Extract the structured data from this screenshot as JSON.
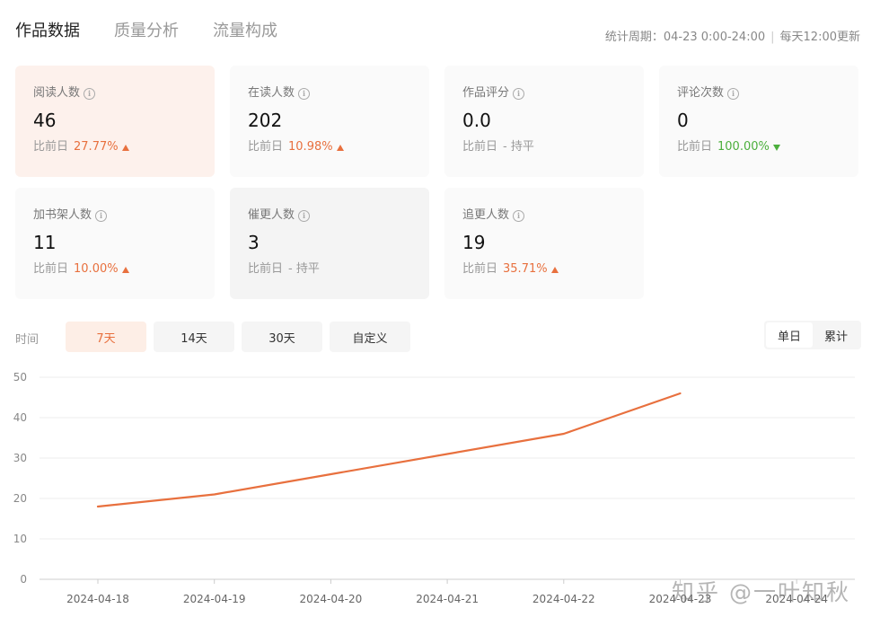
{
  "tabs": [
    {
      "label": "作品数据",
      "active": true
    },
    {
      "label": "质量分析",
      "active": false
    },
    {
      "label": "流量构成",
      "active": false
    }
  ],
  "period": {
    "label": "统计周期：04-23 0:00-24:00",
    "refresh": "每天12:00更新"
  },
  "cards": [
    {
      "label": "阅读人数",
      "value": "46",
      "compare_label": "比前日",
      "change": "27.77%",
      "trend": "up"
    },
    {
      "label": "在读人数",
      "value": "202",
      "compare_label": "比前日",
      "change": "10.98%",
      "trend": "up"
    },
    {
      "label": "作品评分",
      "value": "0.0",
      "compare_label": "比前日",
      "change": "- 持平",
      "trend": "flat"
    },
    {
      "label": "评论次数",
      "value": "0",
      "compare_label": "比前日",
      "change": "100.00%",
      "trend": "down"
    },
    {
      "label": "加书架人数",
      "value": "11",
      "compare_label": "比前日",
      "change": "10.00%",
      "trend": "up"
    },
    {
      "label": "催更人数",
      "value": "3",
      "compare_label": "比前日",
      "change": "- 持平",
      "trend": "flat"
    },
    {
      "label": "追更人数",
      "value": "19",
      "compare_label": "比前日",
      "change": "35.71%",
      "trend": "up"
    }
  ],
  "time_filter": {
    "label": "时间",
    "options": [
      "7天",
      "14天",
      "30天",
      "自定义"
    ],
    "selected": "7天"
  },
  "view_toggle": {
    "options": [
      "单日",
      "累计"
    ],
    "selected": "单日"
  },
  "chart_data": {
    "type": "line",
    "x": [
      "2024-04-18",
      "2024-04-19",
      "2024-04-20",
      "2024-04-21",
      "2024-04-22",
      "2024-04-23",
      "2024-04-24"
    ],
    "series": [
      {
        "values": [
          18,
          21,
          26,
          31,
          36,
          46,
          null
        ]
      }
    ],
    "ylim": [
      0,
      50
    ],
    "yticks": [
      0,
      10,
      20,
      30,
      40,
      50
    ],
    "grid": true,
    "line_color": "#e8703e"
  },
  "watermark": "知乎 @一叶知秋"
}
